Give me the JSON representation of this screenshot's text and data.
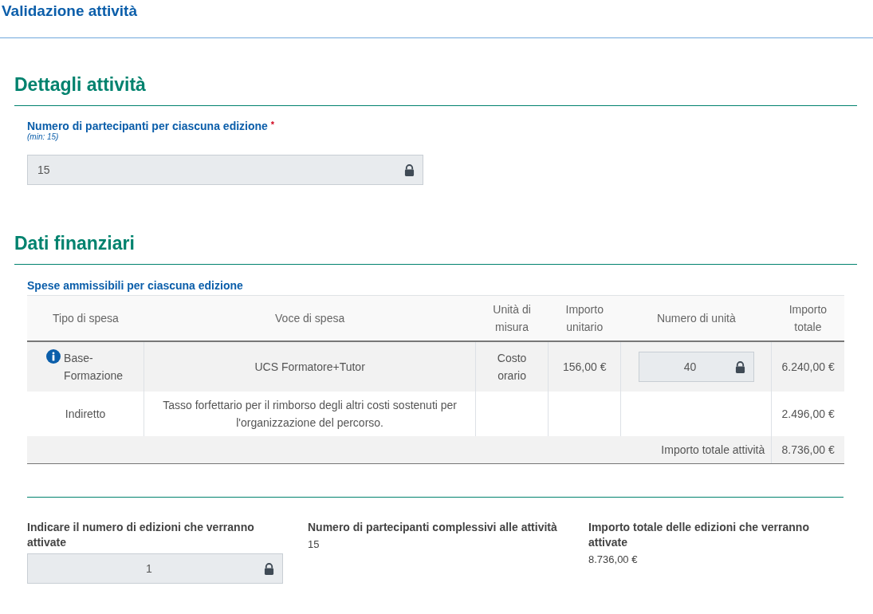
{
  "page_title": "Validazione attività",
  "sections": [
    {
      "title": "Dettagli attività",
      "field": {
        "label": "Numero di partecipanti per ciascuna edizione",
        "required": true,
        "required_mark": "*",
        "hint": "(min: 15)",
        "value": "15",
        "locked": true
      }
    },
    {
      "title": "Dati finanziari",
      "table": {
        "caption": "Spese ammissibili per ciascuna edizione",
        "columns": [
          "Tipo di spesa",
          "Voce di spesa",
          "Unità di misura",
          "Importo unitario",
          "Numero di unità",
          "Importo totale"
        ],
        "rows": [
          {
            "tipo": "Base-Formazione",
            "info": true,
            "voce": "UCS Formatore+Tutor",
            "unita": "Costo orario",
            "importo_unitario": "156,00 €",
            "numero": {
              "value": "40",
              "locked": true
            },
            "importo_totale": "6.240,00 €"
          },
          {
            "tipo": "Indiretto",
            "info": false,
            "voce": "Tasso forfettario per il rimborso degli altri costi sostenuti per l'organizzazione del percorso.",
            "unita": "",
            "importo_unitario": "",
            "numero": null,
            "importo_totale": "2.496,00 €"
          }
        ],
        "footer": {
          "label": "Importo totale attività",
          "value": "8.736,00 €"
        }
      }
    }
  ],
  "summary": [
    {
      "kind": "input",
      "label": "Indicare il numero di edizioni che verranno attivate",
      "value": "1",
      "locked": true
    },
    {
      "kind": "text",
      "label": "Numero di partecipanti complessivi alle attività",
      "value": "15"
    },
    {
      "kind": "text",
      "label": "Importo totale delle edizioni che verranno attivate",
      "value": "8.736,00 €"
    }
  ]
}
